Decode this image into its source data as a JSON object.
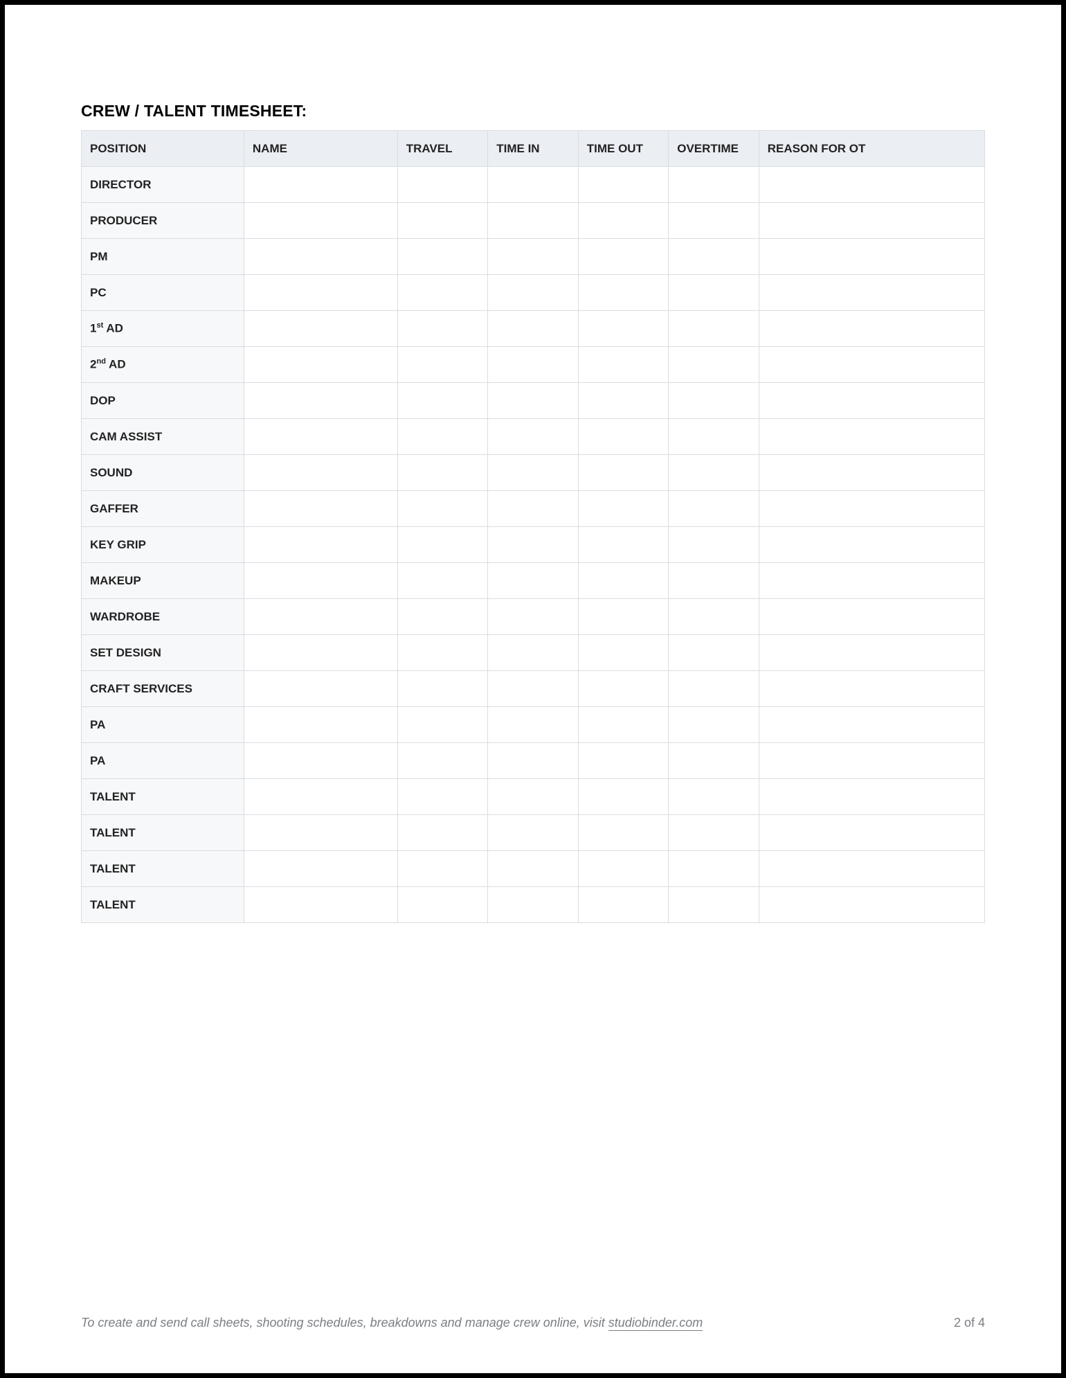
{
  "title": "CREW / TALENT TIMESHEET:",
  "columns": {
    "position": "POSITION",
    "name": "NAME",
    "travel": "TRAVEL",
    "time_in": "TIME IN",
    "time_out": "TIME OUT",
    "overtime": "OVERTIME",
    "reason": "REASON FOR OT"
  },
  "rows": [
    {
      "position": "DIRECTOR",
      "name": "",
      "travel": "",
      "time_in": "",
      "time_out": "",
      "overtime": "",
      "reason": ""
    },
    {
      "position": "PRODUCER",
      "name": "",
      "travel": "",
      "time_in": "",
      "time_out": "",
      "overtime": "",
      "reason": ""
    },
    {
      "position": "PM",
      "name": "",
      "travel": "",
      "time_in": "",
      "time_out": "",
      "overtime": "",
      "reason": ""
    },
    {
      "position": "PC",
      "name": "",
      "travel": "",
      "time_in": "",
      "time_out": "",
      "overtime": "",
      "reason": ""
    },
    {
      "position_html": "1<span class='sup'>st</span> AD",
      "position": "1st AD",
      "name": "",
      "travel": "",
      "time_in": "",
      "time_out": "",
      "overtime": "",
      "reason": ""
    },
    {
      "position_html": "2<span class='sup'>nd</span> AD",
      "position": "2nd AD",
      "name": "",
      "travel": "",
      "time_in": "",
      "time_out": "",
      "overtime": "",
      "reason": ""
    },
    {
      "position": "DOP",
      "name": "",
      "travel": "",
      "time_in": "",
      "time_out": "",
      "overtime": "",
      "reason": ""
    },
    {
      "position": "CAM ASSIST",
      "name": "",
      "travel": "",
      "time_in": "",
      "time_out": "",
      "overtime": "",
      "reason": ""
    },
    {
      "position": "SOUND",
      "name": "",
      "travel": "",
      "time_in": "",
      "time_out": "",
      "overtime": "",
      "reason": ""
    },
    {
      "position": "GAFFER",
      "name": "",
      "travel": "",
      "time_in": "",
      "time_out": "",
      "overtime": "",
      "reason": ""
    },
    {
      "position": "KEY GRIP",
      "name": "",
      "travel": "",
      "time_in": "",
      "time_out": "",
      "overtime": "",
      "reason": ""
    },
    {
      "position": "MAKEUP",
      "name": "",
      "travel": "",
      "time_in": "",
      "time_out": "",
      "overtime": "",
      "reason": ""
    },
    {
      "position": "WARDROBE",
      "name": "",
      "travel": "",
      "time_in": "",
      "time_out": "",
      "overtime": "",
      "reason": ""
    },
    {
      "position": "SET DESIGN",
      "name": "",
      "travel": "",
      "time_in": "",
      "time_out": "",
      "overtime": "",
      "reason": ""
    },
    {
      "position": "CRAFT SERVICES",
      "name": "",
      "travel": "",
      "time_in": "",
      "time_out": "",
      "overtime": "",
      "reason": ""
    },
    {
      "position": "PA",
      "name": "",
      "travel": "",
      "time_in": "",
      "time_out": "",
      "overtime": "",
      "reason": ""
    },
    {
      "position": "PA",
      "name": "",
      "travel": "",
      "time_in": "",
      "time_out": "",
      "overtime": "",
      "reason": ""
    },
    {
      "position": "TALENT",
      "name": "",
      "travel": "",
      "time_in": "",
      "time_out": "",
      "overtime": "",
      "reason": ""
    },
    {
      "position": "TALENT",
      "name": "",
      "travel": "",
      "time_in": "",
      "time_out": "",
      "overtime": "",
      "reason": ""
    },
    {
      "position": "TALENT",
      "name": "",
      "travel": "",
      "time_in": "",
      "time_out": "",
      "overtime": "",
      "reason": ""
    },
    {
      "position": "TALENT",
      "name": "",
      "travel": "",
      "time_in": "",
      "time_out": "",
      "overtime": "",
      "reason": ""
    }
  ],
  "footer": {
    "note_prefix": "To create and send call sheets, shooting schedules, breakdowns and manage crew online, visit ",
    "link_text": "studiobinder.com",
    "page_number": "2 of 4"
  }
}
